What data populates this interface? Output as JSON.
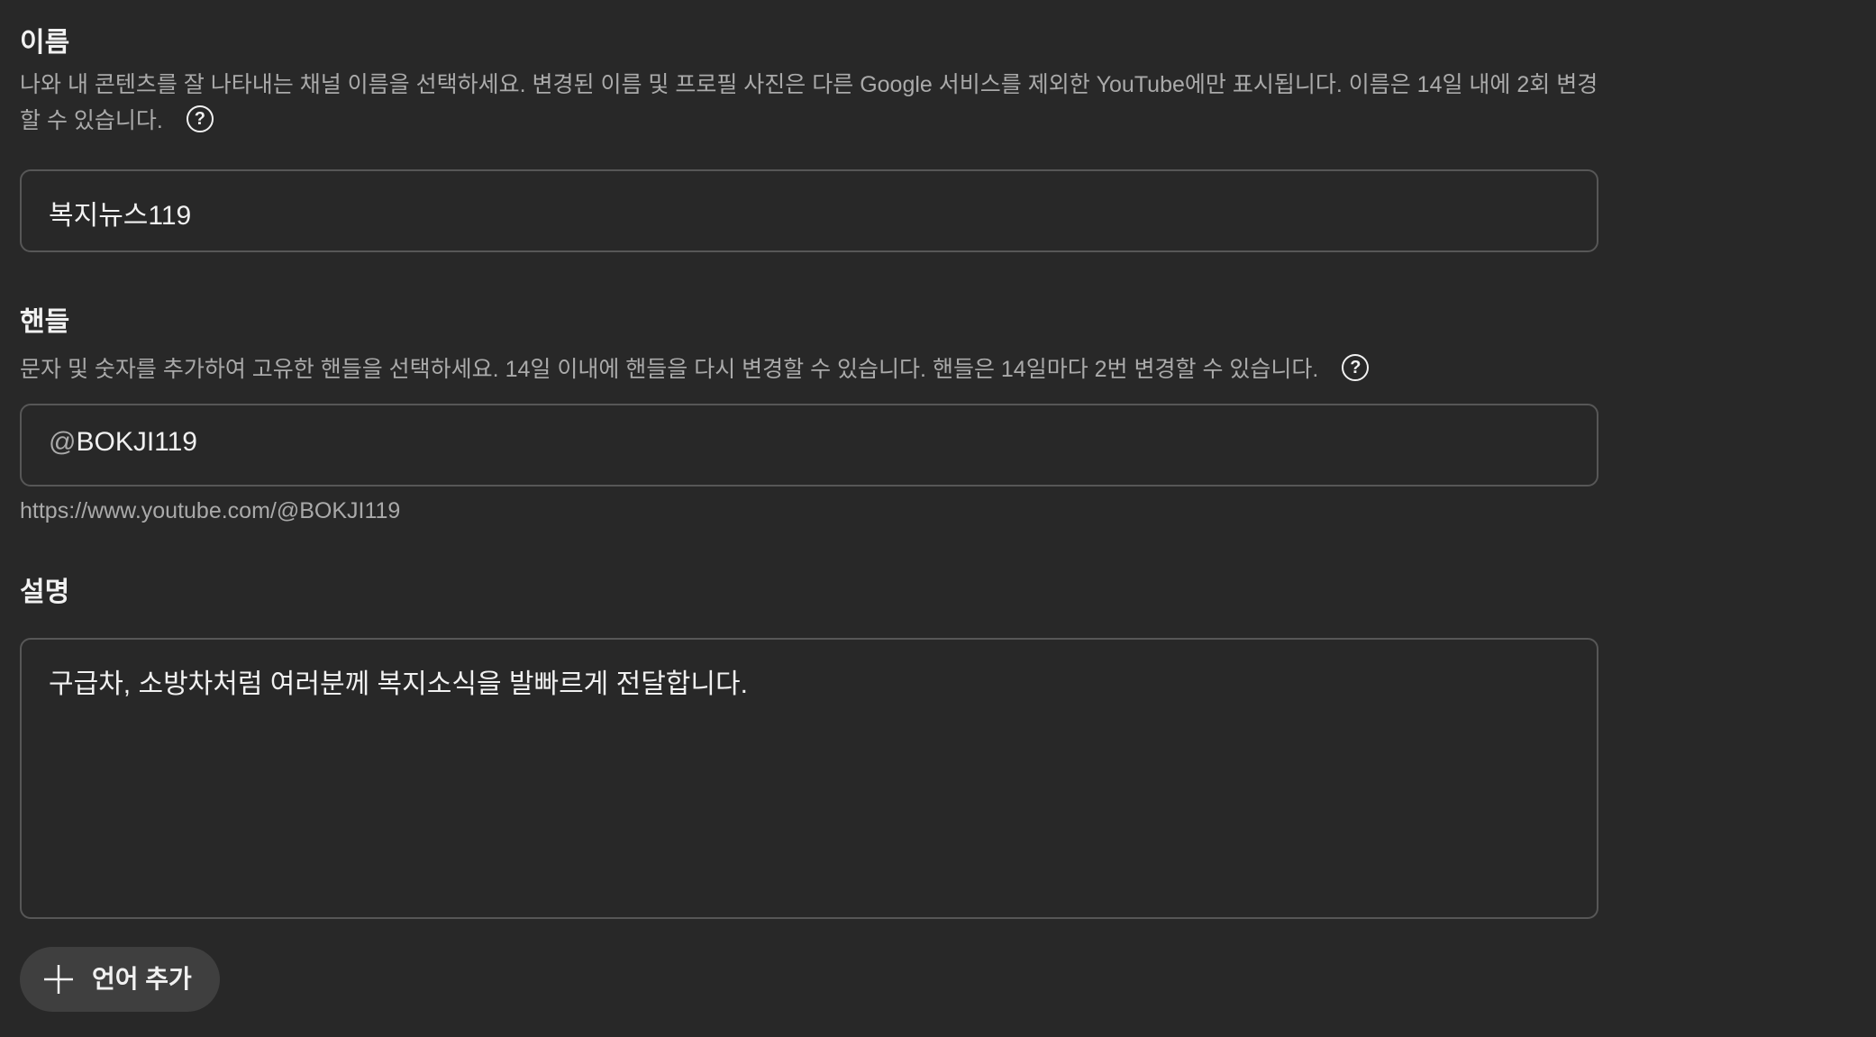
{
  "name_section": {
    "title": "이름",
    "description": "나와 내 콘텐츠를 잘 나타내는 채널 이름을 선택하세요. 변경된 이름 및 프로필 사진은 다른 Google 서비스를 제외한 YouTube에만 표시됩니다. 이름은 14일 내에 2회 변경할 수 있습니다.",
    "help_icon": "?",
    "value": "복지뉴스119"
  },
  "handle_section": {
    "title": "핸들",
    "description": "문자 및 숫자를 추가하여 고유한 핸들을 선택하세요. 14일 이내에 핸들을 다시 변경할 수 있습니다. 핸들은 14일마다 2번 변경할 수 있습니다.",
    "help_icon": "?",
    "prefix": "@",
    "value": "BOKJI119",
    "url": "https://www.youtube.com/@BOKJI119"
  },
  "description_section": {
    "title": "설명",
    "value": "구급차, 소방차처럼 여러분께 복지소식을 발빠르게 전달합니다."
  },
  "add_language": {
    "label": "언어 추가",
    "icon": "plus-icon"
  },
  "colors": {
    "background": "#282828",
    "text_primary": "#f1f1f1",
    "text_secondary": "#aaaaaa",
    "border": "#575757",
    "button_bg": "#3f3f3f"
  }
}
